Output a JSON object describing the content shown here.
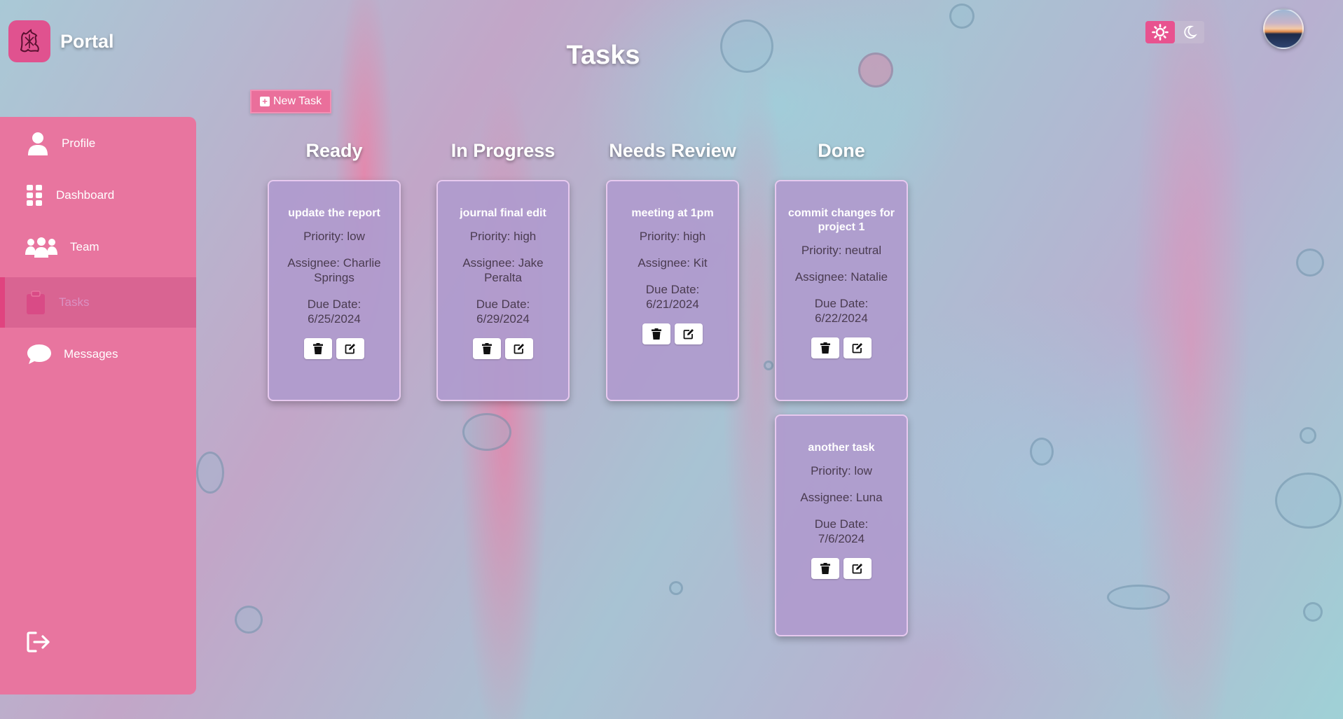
{
  "brand": {
    "name": "Portal",
    "logo": "dragon-logo-icon"
  },
  "header": {
    "title": "Tasks",
    "theme_light_icon": "sun-icon",
    "theme_dark_icon": "moon-icon"
  },
  "actions": {
    "new_task_label": "New Task"
  },
  "sidebar": {
    "items": [
      {
        "label": "Profile",
        "icon": "user-icon"
      },
      {
        "label": "Dashboard",
        "icon": "grid-icon"
      },
      {
        "label": "Team",
        "icon": "team-icon"
      },
      {
        "label": "Tasks",
        "icon": "clipboard-icon",
        "active": true
      },
      {
        "label": "Messages",
        "icon": "chat-icon"
      }
    ],
    "logout_icon": "logout-icon"
  },
  "board": {
    "columns": [
      {
        "title": "Ready",
        "cards": [
          {
            "title": "update the report",
            "priority": "Priority: low",
            "assignee": "Assignee: Charlie Springs",
            "due_label": "Due Date:",
            "due": "6/25/2024"
          }
        ]
      },
      {
        "title": "In Progress",
        "cards": [
          {
            "title": "journal final edit",
            "priority": "Priority: high",
            "assignee": "Assignee: Jake Peralta",
            "due_label": "Due Date:",
            "due": "6/29/2024"
          }
        ]
      },
      {
        "title": "Needs Review",
        "cards": [
          {
            "title": "meeting at 1pm",
            "priority": "Priority: high",
            "assignee": "Assignee: Kit",
            "due_label": "Due Date:",
            "due": "6/21/2024"
          }
        ]
      },
      {
        "title": "Done",
        "cards": [
          {
            "title": "commit changes for project 1",
            "priority": "Priority: neutral",
            "assignee": "Assignee: Natalie",
            "due_label": "Due Date:",
            "due": "6/22/2024"
          },
          {
            "title": "another task",
            "priority": "Priority: low",
            "assignee": "Assignee: Luna",
            "due_label": "Due Date:",
            "due": "7/6/2024"
          }
        ]
      }
    ]
  },
  "colors": {
    "accent": "#e8759f",
    "card": "#af9bcd",
    "active_toggle": "#e8528f"
  }
}
